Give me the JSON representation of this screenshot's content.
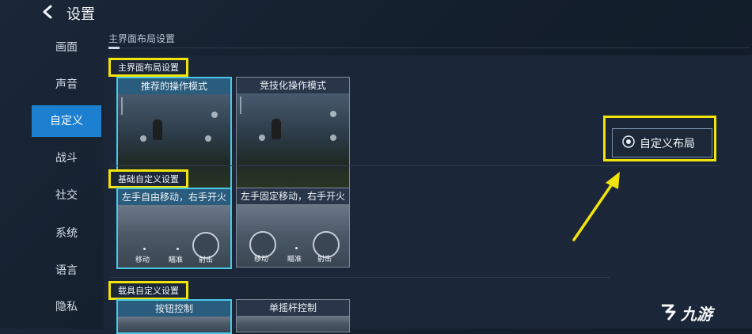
{
  "header": {
    "title": "设置"
  },
  "sidebar": {
    "items": [
      {
        "label": "画面"
      },
      {
        "label": "声音"
      },
      {
        "label": "自定义"
      },
      {
        "label": "战斗"
      },
      {
        "label": "社交"
      },
      {
        "label": "系统"
      },
      {
        "label": "语言"
      },
      {
        "label": "隐私"
      }
    ],
    "active_index": 2
  },
  "main": {
    "section_title": "主界面布局设置",
    "groups": [
      {
        "label": "主界面布局设置",
        "cards": [
          {
            "caption": "推荐的操作模式",
            "selected": true
          },
          {
            "caption": "竞技化操作模式",
            "selected": false
          }
        ]
      },
      {
        "label": "基础自定义设置",
        "cards": [
          {
            "caption": "左手自由移动，右手开火",
            "selected": true,
            "labels": [
              "移动",
              "瞄准",
              "射击"
            ]
          },
          {
            "caption": "左手固定移动，右手开火",
            "selected": false,
            "labels": [
              "移动",
              "瞄准",
              "射击"
            ]
          }
        ]
      },
      {
        "label": "载具自定义设置",
        "cards": [
          {
            "caption": "按钮控制",
            "selected": true
          },
          {
            "caption": "单摇杆控制",
            "selected": false
          }
        ]
      }
    ]
  },
  "custom_layout_button": {
    "label": "自定义布局",
    "icon": "target-icon"
  },
  "watermark": {
    "text": "九游"
  },
  "colors": {
    "accent": "#1d7fd0",
    "highlight": "#f2e40b",
    "selected_border": "#48c9e6",
    "arrow": "#f2e40b"
  }
}
